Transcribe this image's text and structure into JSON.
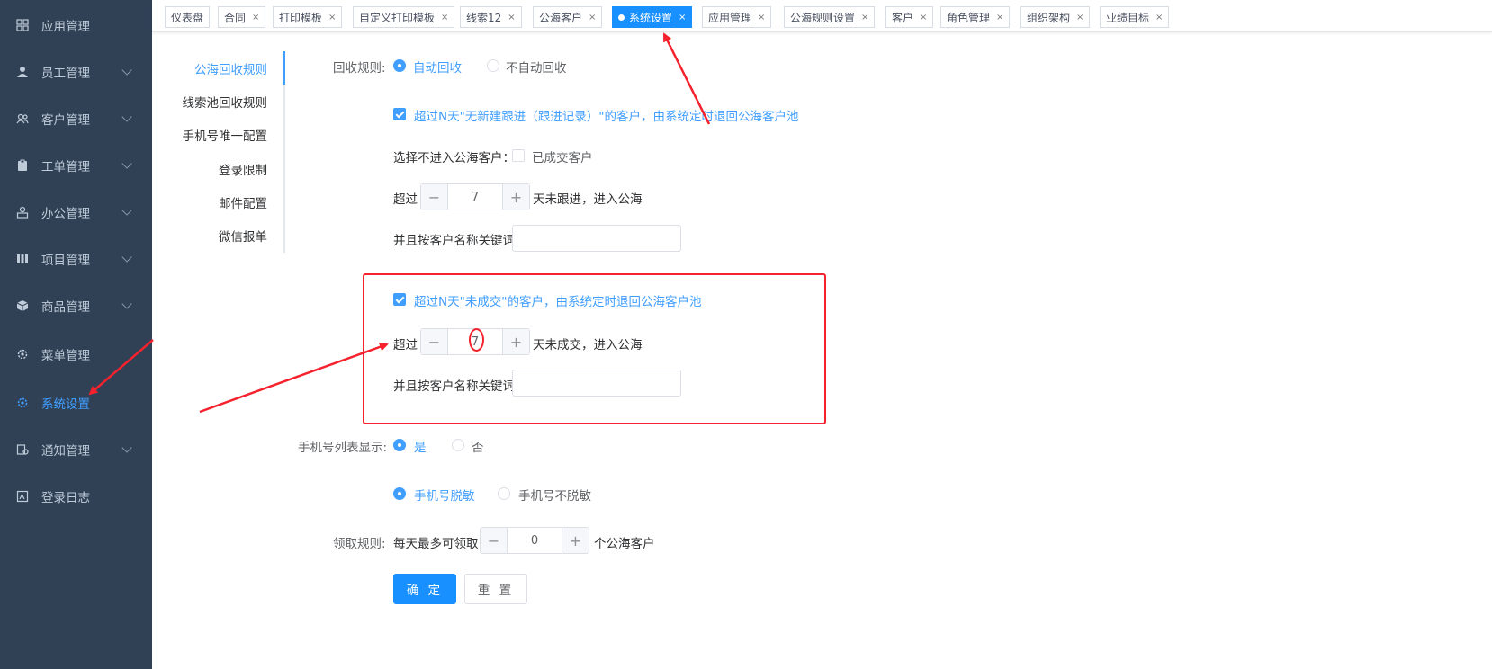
{
  "sidebar": {
    "items": [
      {
        "label": "应用管理",
        "icon": "grid-icon",
        "has_submenu": false
      },
      {
        "label": "员工管理",
        "icon": "user-icon",
        "has_submenu": true
      },
      {
        "label": "客户管理",
        "icon": "customers-icon",
        "has_submenu": true
      },
      {
        "label": "工单管理",
        "icon": "clipboard-icon",
        "has_submenu": true
      },
      {
        "label": "办公管理",
        "icon": "office-icon",
        "has_submenu": true
      },
      {
        "label": "项目管理",
        "icon": "project-icon",
        "has_submenu": true
      },
      {
        "label": "商品管理",
        "icon": "box-icon",
        "has_submenu": true
      },
      {
        "label": "菜单管理",
        "icon": "menu-settings-icon",
        "has_submenu": false
      },
      {
        "label": "系统设置",
        "icon": "gear-icon",
        "has_submenu": false,
        "active": true
      },
      {
        "label": "通知管理",
        "icon": "notification-icon",
        "has_submenu": true
      },
      {
        "label": "登录日志",
        "icon": "log-icon",
        "has_submenu": false
      }
    ]
  },
  "tabs": [
    {
      "label": "仪表盘",
      "closable": false
    },
    {
      "label": "合同",
      "closable": true
    },
    {
      "label": "打印模板",
      "closable": true
    },
    {
      "label": "自定义打印模板",
      "closable": true
    },
    {
      "label": "线索12",
      "closable": true
    },
    {
      "label": "公海客户",
      "closable": true
    },
    {
      "label": "系统设置",
      "closable": true,
      "active": true
    },
    {
      "label": "应用管理",
      "closable": true
    },
    {
      "label": "公海规则设置",
      "closable": true
    },
    {
      "label": "客户",
      "closable": true
    },
    {
      "label": "角色管理",
      "closable": true
    },
    {
      "label": "组织架构",
      "closable": true
    },
    {
      "label": "业绩目标",
      "closable": true
    }
  ],
  "close_glyph": "×",
  "subnav": {
    "items": [
      "公海回收规则",
      "线索池回收规则",
      "手机号唯一配置",
      "登录限制",
      "邮件配置",
      "微信报单"
    ],
    "active_index": 0
  },
  "form": {
    "recycle_rule": {
      "label": "回收规则:",
      "options": [
        "自动回收",
        "不自动回收"
      ],
      "selected": "自动回收"
    },
    "no_followup_check": {
      "label": "超过N天\"无新建跟进（跟进记录）\"的客户，由系统定时退回公海客户池",
      "checked": true
    },
    "exclude": {
      "label": "选择不进入公海客户：",
      "option": "已成交客户",
      "checked": false
    },
    "followup_days": {
      "prefix": "超过",
      "value": "7",
      "suffix": "天未跟进，进入公海"
    },
    "keyword1": {
      "label": "并且按客户名称关键词",
      "value": ""
    },
    "no_deal_check": {
      "label": "超过N天\"未成交\"的客户，由系统定时退回公海客户池",
      "checked": true
    },
    "deal_days": {
      "prefix": "超过",
      "value": "7",
      "suffix": "天未成交，进入公海"
    },
    "keyword2": {
      "label": "并且按客户名称关键词",
      "value": ""
    },
    "phone_display": {
      "label": "手机号列表显示:",
      "options": [
        "是",
        "否"
      ],
      "selected": "是"
    },
    "phone_mask": {
      "options": [
        "手机号脱敏",
        "手机号不脱敏"
      ],
      "selected": "手机号脱敏"
    },
    "claim_rule": {
      "label": "领取规则:",
      "prefix": "每天最多可领取",
      "value": "0",
      "suffix": "个公海客户"
    },
    "buttons": {
      "confirm": "确 定",
      "reset": "重 置"
    },
    "stepper_dec": "−",
    "stepper_inc": "+"
  },
  "colors": {
    "accent": "#1890ff",
    "sidebar_bg": "#304156",
    "annotation_red": "#f5222d"
  }
}
